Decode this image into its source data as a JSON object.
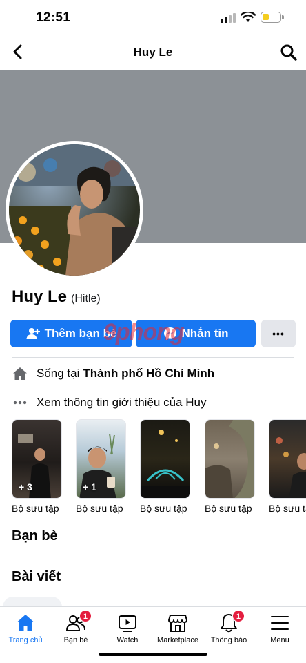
{
  "status_bar": {
    "time": "12:51",
    "battery_level": 0.4,
    "battery_color": "#f4cd1f"
  },
  "header": {
    "title": "Huy Le",
    "back_icon": "chevron-left-icon",
    "search_icon": "search-icon"
  },
  "profile": {
    "name": "Huy Le",
    "alternate_name": "(Hitle)",
    "cover_color": "#8c9196"
  },
  "actions": {
    "add_friend_label": "Thêm bạn bè",
    "message_label": "Nhắn tin",
    "more_label": "•••",
    "accent": "#1877f2"
  },
  "watermark": "9phong",
  "intro": {
    "lives_in_prefix": "Sống tại",
    "lives_in_city": "Thành phố Hồ Chí Minh",
    "see_about": "Xem thông tin giới thiệu của Huy"
  },
  "collections": [
    {
      "label": "Bộ sưu tập",
      "count": "+ 3"
    },
    {
      "label": "Bộ sưu tập",
      "count": "+ 1"
    },
    {
      "label": "Bộ sưu tập",
      "count": ""
    },
    {
      "label": "Bộ sưu tập",
      "count": ""
    },
    {
      "label": "Bộ sưu tập",
      "count": ""
    }
  ],
  "sections": {
    "friends": "Bạn bè",
    "posts": "Bài viết"
  },
  "tab_bar": {
    "items": [
      {
        "label": "Trang chủ",
        "icon": "home-icon",
        "active": true,
        "badge": ""
      },
      {
        "label": "Bạn bè",
        "icon": "friends-icon",
        "active": false,
        "badge": "1"
      },
      {
        "label": "Watch",
        "icon": "watch-icon",
        "active": false,
        "badge": ""
      },
      {
        "label": "Marketplace",
        "icon": "marketplace-icon",
        "active": false,
        "badge": ""
      },
      {
        "label": "Thông báo",
        "icon": "bell-icon",
        "active": false,
        "badge": "1"
      },
      {
        "label": "Menu",
        "icon": "menu-icon",
        "active": false,
        "badge": ""
      }
    ]
  }
}
